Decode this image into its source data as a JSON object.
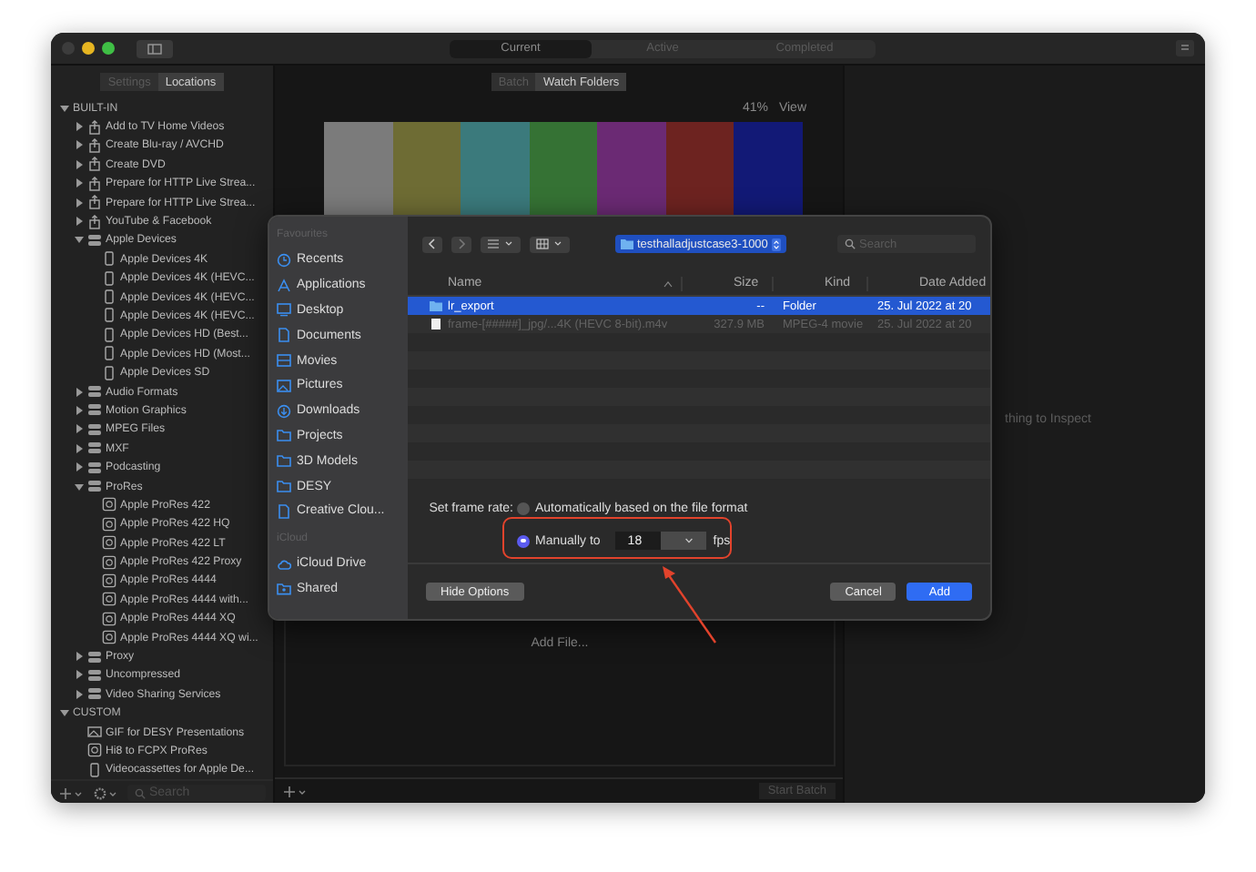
{
  "window": {
    "tabs": [
      {
        "label": "Current",
        "selected": true
      },
      {
        "label": "Active",
        "selected": false
      },
      {
        "label": "Completed",
        "selected": false
      }
    ]
  },
  "sidebar": {
    "segments": [
      {
        "label": "Settings",
        "selected": false
      },
      {
        "label": "Locations",
        "selected": true
      }
    ],
    "tree": [
      {
        "label": "BUILT-IN",
        "kind": "header",
        "expanded": true,
        "children": [
          {
            "label": "Add to TV Home Videos",
            "kind": "destination",
            "expanded": false
          },
          {
            "label": "Create Blu-ray / AVCHD",
            "kind": "destination",
            "expanded": false
          },
          {
            "label": "Create DVD",
            "kind": "destination",
            "expanded": false
          },
          {
            "label": "Prepare for HTTP Live Strea...",
            "kind": "destination",
            "expanded": false
          },
          {
            "label": "Prepare for HTTP Live Strea...",
            "kind": "destination",
            "expanded": false
          },
          {
            "label": "YouTube & Facebook",
            "kind": "destination",
            "expanded": false
          },
          {
            "label": "Apple Devices",
            "kind": "group",
            "expanded": true,
            "children": [
              {
                "label": "Apple Devices 4K",
                "kind": "device"
              },
              {
                "label": "Apple Devices 4K (HEVC...",
                "kind": "device"
              },
              {
                "label": "Apple Devices 4K (HEVC...",
                "kind": "device"
              },
              {
                "label": "Apple Devices 4K (HEVC...",
                "kind": "device"
              },
              {
                "label": "Apple Devices HD (Best...",
                "kind": "device"
              },
              {
                "label": "Apple Devices HD (Most...",
                "kind": "device"
              },
              {
                "label": "Apple Devices SD",
                "kind": "device"
              }
            ]
          },
          {
            "label": "Audio Formats",
            "kind": "group",
            "expanded": false
          },
          {
            "label": "Motion Graphics",
            "kind": "group",
            "expanded": false
          },
          {
            "label": "MPEG Files",
            "kind": "group",
            "expanded": false
          },
          {
            "label": "MXF",
            "kind": "group",
            "expanded": false
          },
          {
            "label": "Podcasting",
            "kind": "group",
            "expanded": false
          },
          {
            "label": "ProRes",
            "kind": "group",
            "expanded": true,
            "children": [
              {
                "label": "Apple ProRes 422",
                "kind": "codec"
              },
              {
                "label": "Apple ProRes 422 HQ",
                "kind": "codec"
              },
              {
                "label": "Apple ProRes 422 LT",
                "kind": "codec"
              },
              {
                "label": "Apple ProRes 422 Proxy",
                "kind": "codec"
              },
              {
                "label": "Apple ProRes 4444",
                "kind": "codec"
              },
              {
                "label": "Apple ProRes 4444 with...",
                "kind": "codec"
              },
              {
                "label": "Apple ProRes 4444 XQ",
                "kind": "codec"
              },
              {
                "label": "Apple ProRes 4444 XQ wi...",
                "kind": "codec"
              }
            ]
          },
          {
            "label": "Proxy",
            "kind": "group",
            "expanded": false
          },
          {
            "label": "Uncompressed",
            "kind": "group",
            "expanded": false
          },
          {
            "label": "Video Sharing Services",
            "kind": "group",
            "expanded": false
          }
        ]
      },
      {
        "label": "CUSTOM",
        "kind": "header",
        "expanded": true,
        "children": [
          {
            "label": "GIF for DESY Presentations",
            "kind": "image"
          },
          {
            "label": "Hi8 to FCPX ProRes",
            "kind": "codec"
          },
          {
            "label": "Videocassettes for Apple De...",
            "kind": "device"
          }
        ]
      }
    ],
    "search": {
      "placeholder": "Search"
    }
  },
  "batch": {
    "segments": [
      {
        "label": "Batch",
        "selected": false
      },
      {
        "label": "Watch Folders",
        "selected": true
      }
    ],
    "zoom": "41%",
    "view": "View",
    "add_file": "Add File...",
    "start_batch": {
      "label": "Start Batch",
      "disabled": true
    }
  },
  "inspector": {
    "message": "thing to Inspect"
  },
  "dialog": {
    "sidebar": [
      {
        "header": "Favourites",
        "items": [
          {
            "label": "Recents",
            "kind": "recents"
          },
          {
            "label": "Applications",
            "kind": "applications"
          },
          {
            "label": "Desktop",
            "kind": "desktop"
          },
          {
            "label": "Documents",
            "kind": "document"
          },
          {
            "label": "Movies",
            "kind": "movies"
          },
          {
            "label": "Pictures",
            "kind": "pictures"
          },
          {
            "label": "Downloads",
            "kind": "downloads"
          },
          {
            "label": "Projects",
            "kind": "folder"
          },
          {
            "label": "3D Models",
            "kind": "folder"
          },
          {
            "label": "DESY",
            "kind": "folder"
          },
          {
            "label": "Creative Clou...",
            "kind": "document"
          }
        ]
      },
      {
        "header": "iCloud",
        "items": [
          {
            "label": "iCloud Drive",
            "kind": "cloud"
          },
          {
            "label": "Shared",
            "kind": "shared"
          }
        ]
      }
    ],
    "location": "testhalladjustcase3-1000",
    "search": {
      "placeholder": "Search"
    },
    "columns": [
      "Name",
      "Size",
      "Kind",
      "Date Added"
    ],
    "files": [
      {
        "kind": "folder",
        "name": "lr_export",
        "size": "--",
        "type": "Folder",
        "date": "25. Jul 2022 at 20",
        "selected": true,
        "disabled": false
      },
      {
        "kind": "movie",
        "name": "frame-[#####]_jpg/...4K (HEVC 8-bit).m4v",
        "size": "327.9 MB",
        "type": "MPEG-4 movie",
        "date": "25. Jul 2022 at 20",
        "selected": false,
        "disabled": true
      }
    ],
    "frame_rate": {
      "label": "Set frame rate:",
      "options": [
        {
          "label": "Automatically based on the file format",
          "selected": false
        },
        {
          "label": "Manually to",
          "selected": true
        }
      ],
      "value": "18",
      "unit": "fps"
    },
    "buttons": [
      {
        "label": "Hide Options",
        "kind": "aside"
      },
      {
        "label": "Cancel",
        "kind": "plain"
      },
      {
        "label": "Add",
        "kind": "default"
      }
    ]
  }
}
